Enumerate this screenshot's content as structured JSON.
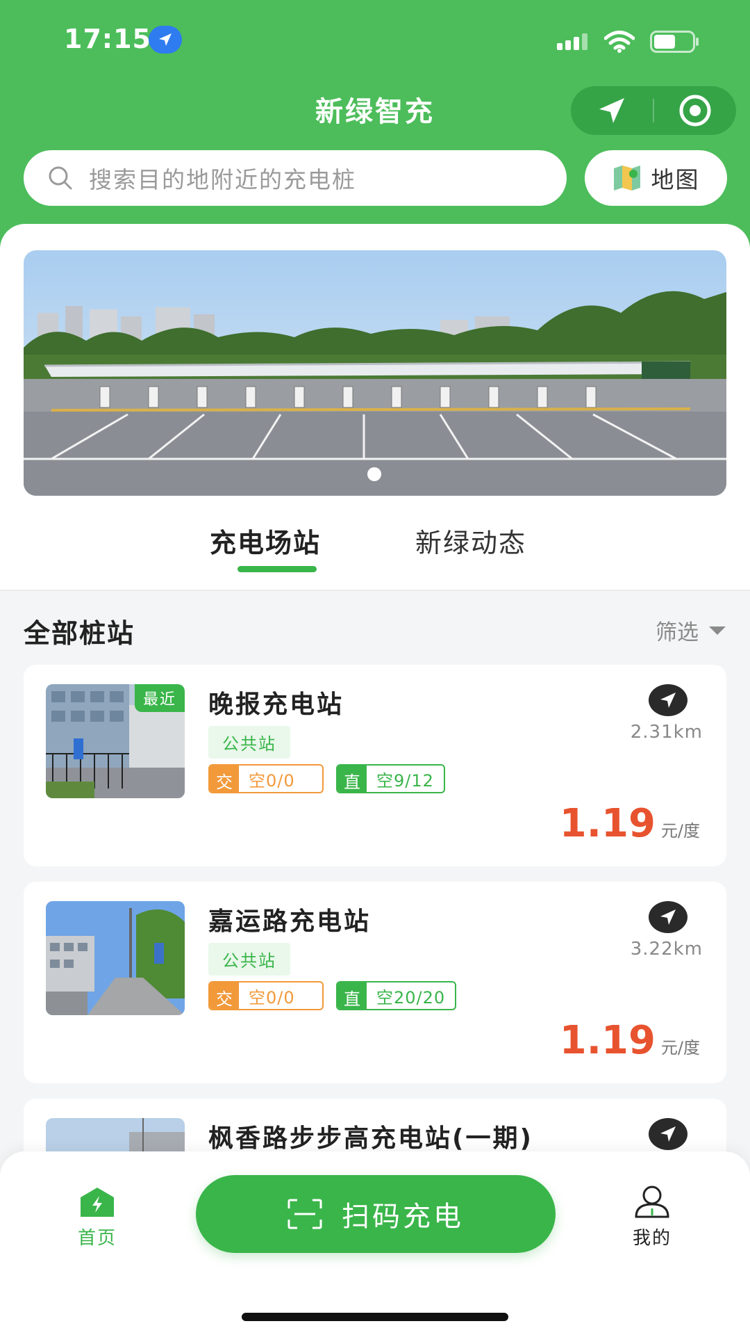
{
  "status_bar": {
    "time": "17:15"
  },
  "header": {
    "title": "新绿智充",
    "search_placeholder": "搜索目的地附近的充电桩",
    "map_label": "地图"
  },
  "tabs": [
    {
      "label": "充电场站",
      "active": true
    },
    {
      "label": "新绿动态",
      "active": false
    }
  ],
  "section": {
    "title": "全部桩站",
    "filter_label": "筛选"
  },
  "stations": [
    {
      "name": "晚报充电站",
      "recent_tag": "最近",
      "type_tag": "公共站",
      "ac_key": "交",
      "ac_value": "空0/0",
      "dc_key": "直",
      "dc_value": "空9/12",
      "distance": "2.31km",
      "price": "1.19",
      "price_unit": "元/度"
    },
    {
      "name": "嘉运路充电站",
      "type_tag": "公共站",
      "ac_key": "交",
      "ac_value": "空0/0",
      "dc_key": "直",
      "dc_value": "空20/20",
      "distance": "3.22km",
      "price": "1.19",
      "price_unit": "元/度"
    },
    {
      "name": "枫香路步步高充电站(一期)"
    }
  ],
  "bottom_nav": {
    "home_label": "首页",
    "scan_label": "扫码充电",
    "mine_label": "我的"
  },
  "colors": {
    "brand_green": "#4cbd5a",
    "accent_green": "#3ab54a",
    "ac_orange": "#f2993a",
    "price_red": "#e8532f"
  }
}
